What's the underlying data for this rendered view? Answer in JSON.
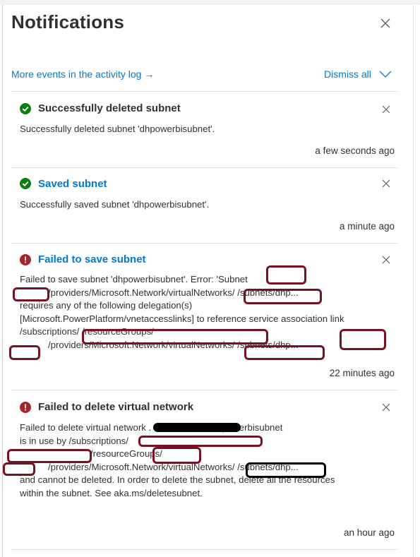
{
  "panel": {
    "title": "Notifications",
    "activity_link": "More events in the activity log →",
    "dismiss_all": "Dismiss all"
  },
  "notifications": [
    {
      "status": "success",
      "icon": "check-circle-icon",
      "title": "Successfully deleted subnet",
      "body": [
        "Successfully deleted subnet 'dhpowerbisubnet'."
      ],
      "time": "a few seconds ago"
    },
    {
      "status": "success",
      "icon": "check-circle-icon",
      "title": "Saved subnet",
      "body": [
        "Successfully saved subnet 'dhpowerbisubnet'."
      ],
      "time": "a minute ago"
    },
    {
      "status": "error",
      "icon": "error-circle-icon",
      "title": "Failed to save subnet",
      "body": [
        "Failed to save subnet 'dhpowerbisubnet'. Error: 'Subnet",
        "/providers/Microsoft.Network/virtualNetworks/                    /subnets/dhp...",
        "requires any of the following delegation(s)",
        "[Microsoft.PowerPlatform/vnetaccesslinks] to reference service association link",
        "/subscriptions/                                                   /resourceGroups/",
        "/providers/Microsoft.Network/virtualNetworks/                    /subnets/dhp..."
      ],
      "time": "22 minutes ago"
    },
    {
      "status": "error",
      "icon": "error-circle-icon",
      "title": "Failed to delete virtual network",
      "body": [
        "Failed to delete virtual network                         . Error: Subnet dhpowerbisubnet",
        "is in use by /subscriptions/",
        "/resourceGroups/",
        "/providers/Microsoft.Network/virtualNetworks/                    /subnets/dhp...",
        "and cannot be deleted. In order to delete the subnet, delete all the resources",
        "within the subnet. See aka.ms/deletesubnet."
      ],
      "time": "an hour ago"
    }
  ],
  "colors": {
    "accent": "#0078d4",
    "success": "#107c10",
    "error": "#a4262c",
    "redaction": "#7a1020"
  }
}
